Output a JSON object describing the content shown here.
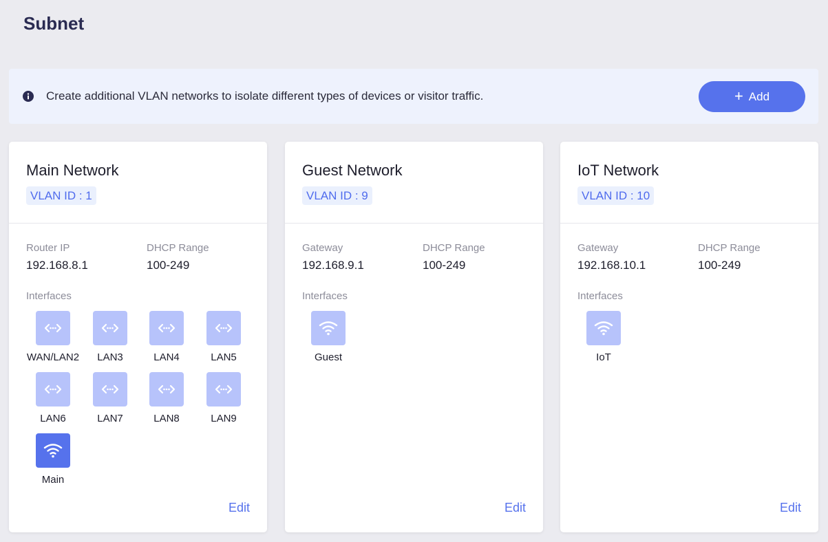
{
  "page": {
    "title": "Subnet"
  },
  "info": {
    "icon": "info-icon",
    "text": "Create additional VLAN networks to isolate different types of devices or visitor traffic.",
    "add_label": "Add"
  },
  "colors": {
    "accent": "#5672ec",
    "tile": "#b7c3fb",
    "badge_bg": "#eaf0fd"
  },
  "cards": [
    {
      "title": "Main Network",
      "vlan": "VLAN ID : 1",
      "ip_label": "Router IP",
      "ip_value": "192.168.8.1",
      "dhcp_label": "DHCP Range",
      "dhcp_value": "100-249",
      "interfaces_label": "Interfaces",
      "interfaces": [
        {
          "name": "WAN/LAN2",
          "icon": "ethernet-port-icon",
          "active": false
        },
        {
          "name": "LAN3",
          "icon": "ethernet-port-icon",
          "active": false
        },
        {
          "name": "LAN4",
          "icon": "ethernet-port-icon",
          "active": false
        },
        {
          "name": "LAN5",
          "icon": "ethernet-port-icon",
          "active": false
        },
        {
          "name": "LAN6",
          "icon": "ethernet-port-icon",
          "active": false
        },
        {
          "name": "LAN7",
          "icon": "ethernet-port-icon",
          "active": false
        },
        {
          "name": "LAN8",
          "icon": "ethernet-port-icon",
          "active": false
        },
        {
          "name": "LAN9",
          "icon": "ethernet-port-icon",
          "active": false
        },
        {
          "name": "Main",
          "icon": "wifi-icon",
          "active": true
        }
      ],
      "edit_label": "Edit"
    },
    {
      "title": "Guest Network",
      "vlan": "VLAN ID : 9",
      "ip_label": "Gateway",
      "ip_value": "192.168.9.1",
      "dhcp_label": "DHCP Range",
      "dhcp_value": "100-249",
      "interfaces_label": "Interfaces",
      "interfaces": [
        {
          "name": "Guest",
          "icon": "wifi-icon",
          "active": false
        }
      ],
      "edit_label": "Edit"
    },
    {
      "title": "IoT Network",
      "vlan": "VLAN ID : 10",
      "ip_label": "Gateway",
      "ip_value": "192.168.10.1",
      "dhcp_label": "DHCP Range",
      "dhcp_value": "100-249",
      "interfaces_label": "Interfaces",
      "interfaces": [
        {
          "name": "IoT",
          "icon": "wifi-icon",
          "active": false
        }
      ],
      "edit_label": "Edit"
    }
  ]
}
